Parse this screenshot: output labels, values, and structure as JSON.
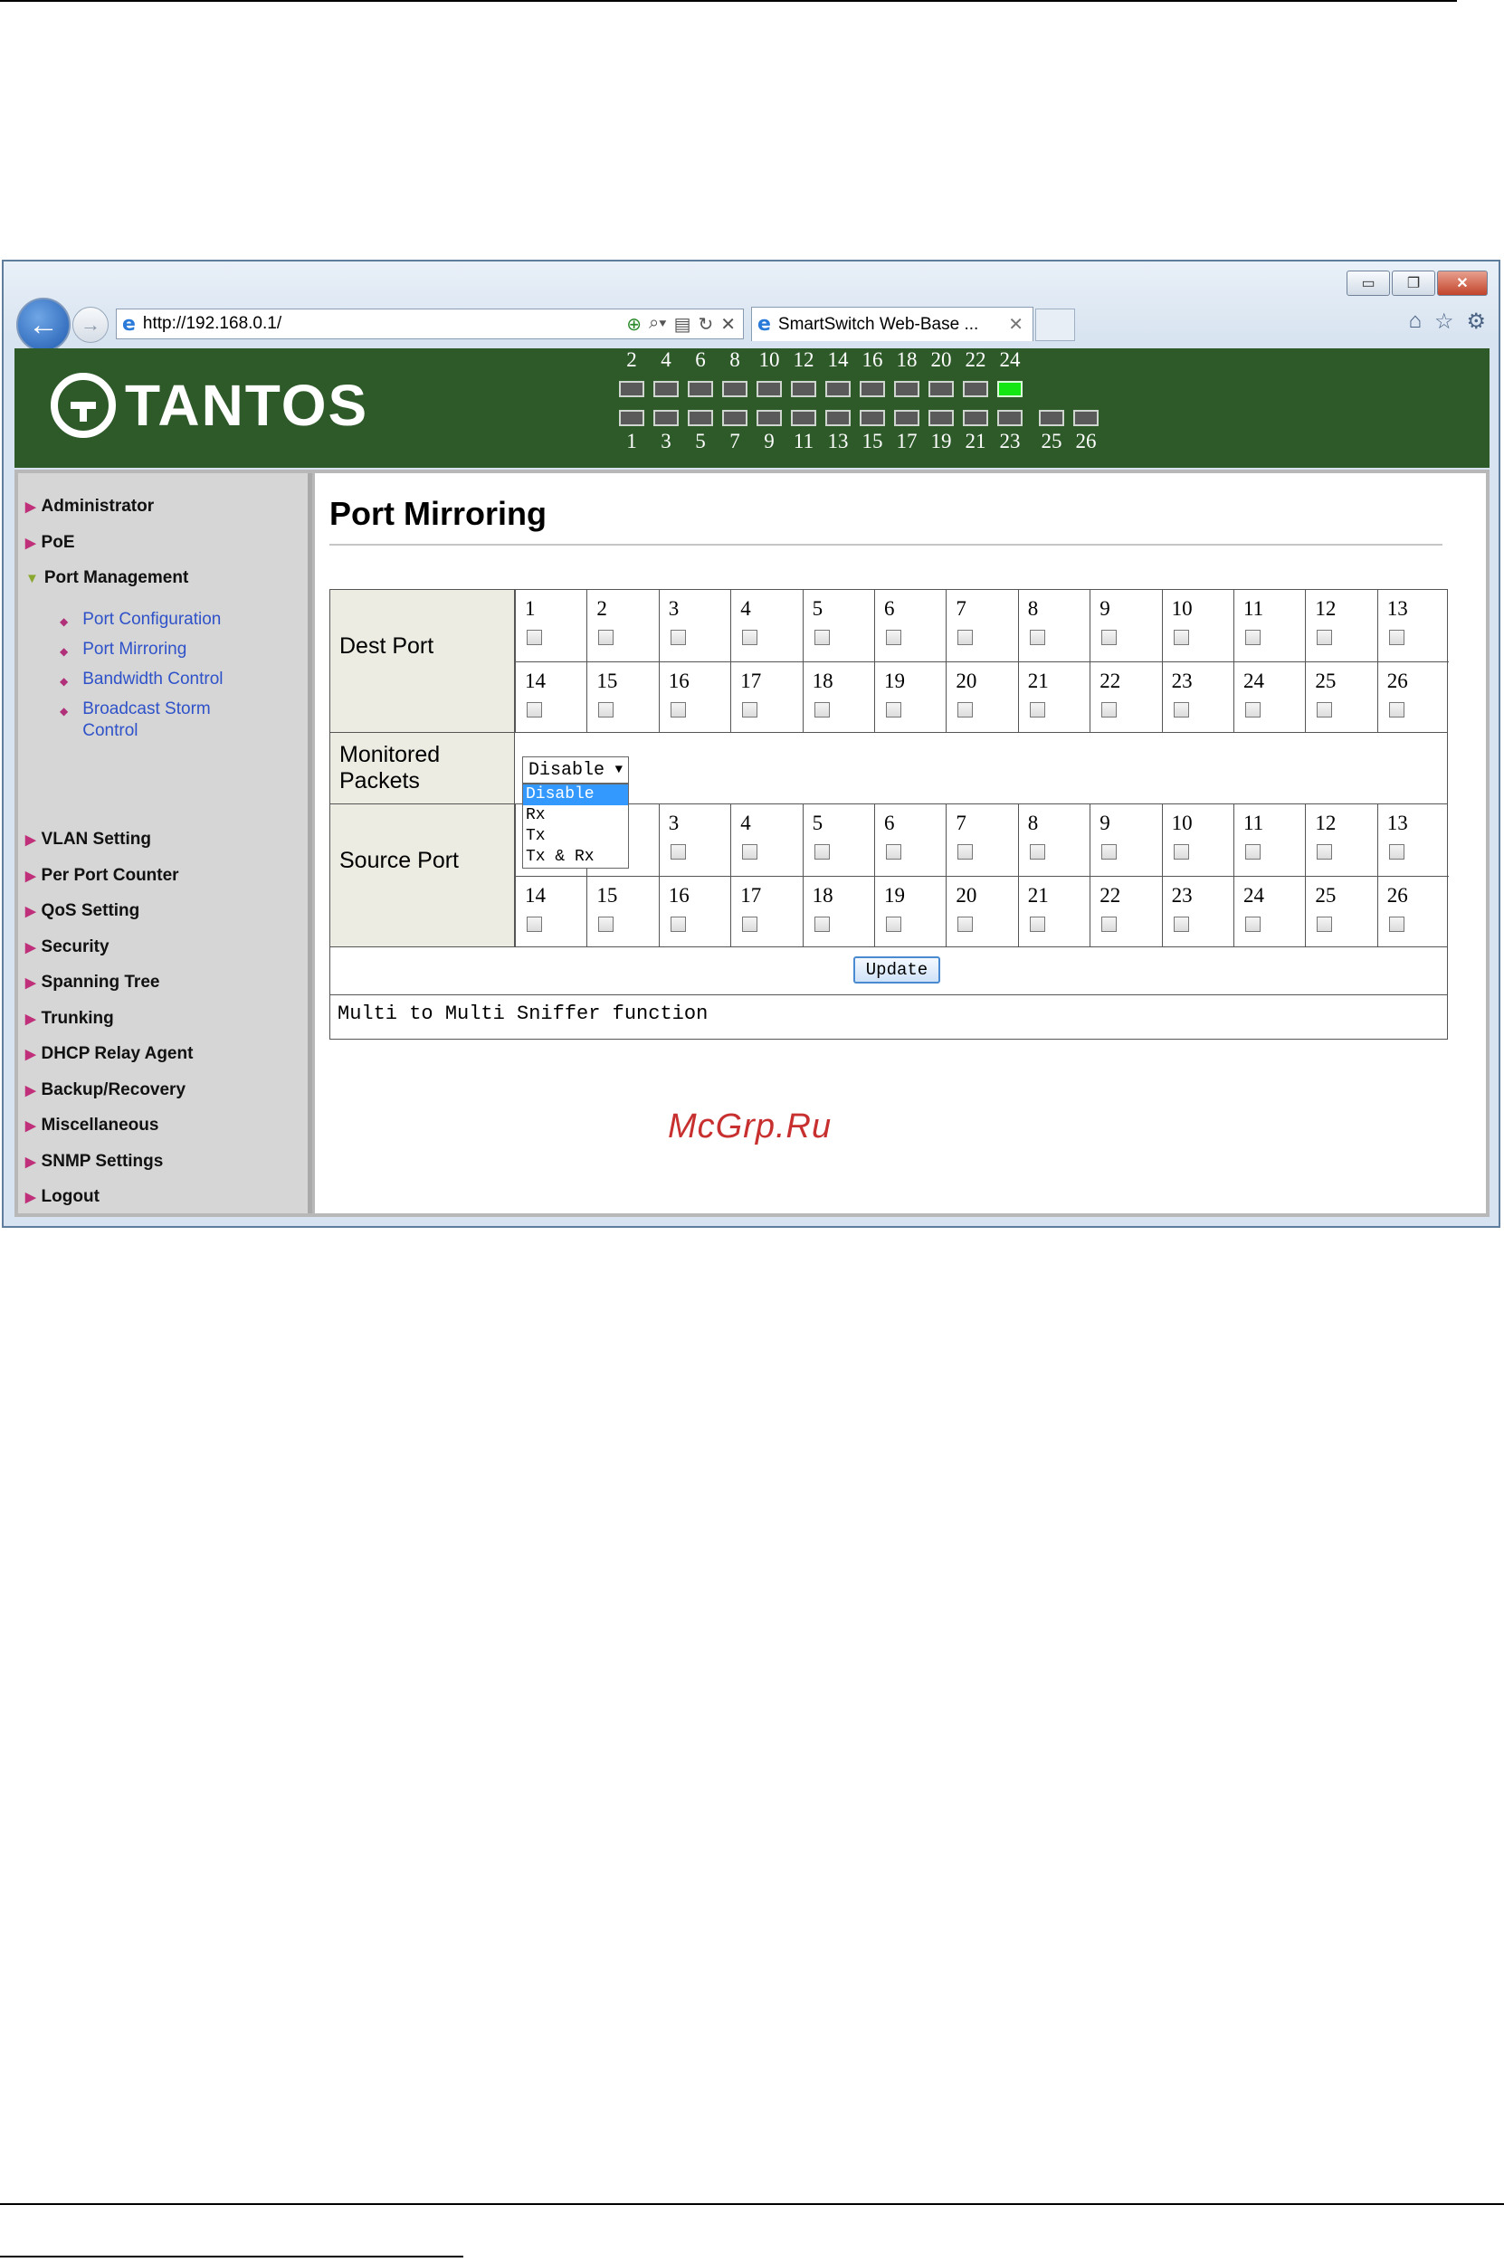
{
  "browser": {
    "url": "http://192.168.0.1/",
    "tab_title": "SmartSwitch Web-Base ...",
    "window_buttons": [
      "minimize",
      "restore",
      "close"
    ]
  },
  "banner": {
    "logo_text": "TANTOS",
    "top_port_numbers": [
      "2",
      "4",
      "6",
      "8",
      "10",
      "12",
      "14",
      "16",
      "18",
      "20",
      "22",
      "24"
    ],
    "bottom_port_numbers": [
      "1",
      "3",
      "5",
      "7",
      "9",
      "11",
      "13",
      "15",
      "17",
      "19",
      "21",
      "23"
    ],
    "uplink_port_numbers": [
      "25",
      "26"
    ],
    "active_ports": [
      "24"
    ],
    "active_color": "#14e614"
  },
  "sidebar": {
    "items": [
      {
        "label": "Administrator"
      },
      {
        "label": "PoE"
      },
      {
        "label": "Port Management",
        "expanded": true
      },
      {
        "label": "VLAN Setting"
      },
      {
        "label": "Per Port Counter"
      },
      {
        "label": "QoS Setting"
      },
      {
        "label": "Security"
      },
      {
        "label": "Spanning Tree"
      },
      {
        "label": "Trunking"
      },
      {
        "label": "DHCP Relay Agent"
      },
      {
        "label": "Backup/Recovery"
      },
      {
        "label": "Miscellaneous"
      },
      {
        "label": "SNMP Settings"
      },
      {
        "label": "Logout"
      }
    ],
    "subitems": [
      {
        "label": "Port Configuration"
      },
      {
        "label": "Port Mirroring"
      },
      {
        "label": "Bandwidth Control"
      },
      {
        "label": "Broadcast Storm Control"
      }
    ]
  },
  "main": {
    "title": "Port Mirroring",
    "dest_label": "Dest Port",
    "monitored_label": "Monitored Packets",
    "source_label": "Source Port",
    "ports_row1": [
      "1",
      "2",
      "3",
      "4",
      "5",
      "6",
      "7",
      "8",
      "9",
      "10",
      "11",
      "12",
      "13"
    ],
    "ports_row2": [
      "14",
      "15",
      "16",
      "17",
      "18",
      "19",
      "20",
      "21",
      "22",
      "23",
      "24",
      "25",
      "26"
    ],
    "monitored_select": {
      "value": "Disable",
      "options": [
        "Disable",
        "Rx",
        "Tx",
        "Tx & Rx"
      ],
      "highlighted": "Disable"
    },
    "update_label": "Update",
    "note": "Multi to Multi Sniffer function"
  },
  "watermark": "McGrp.Ru"
}
